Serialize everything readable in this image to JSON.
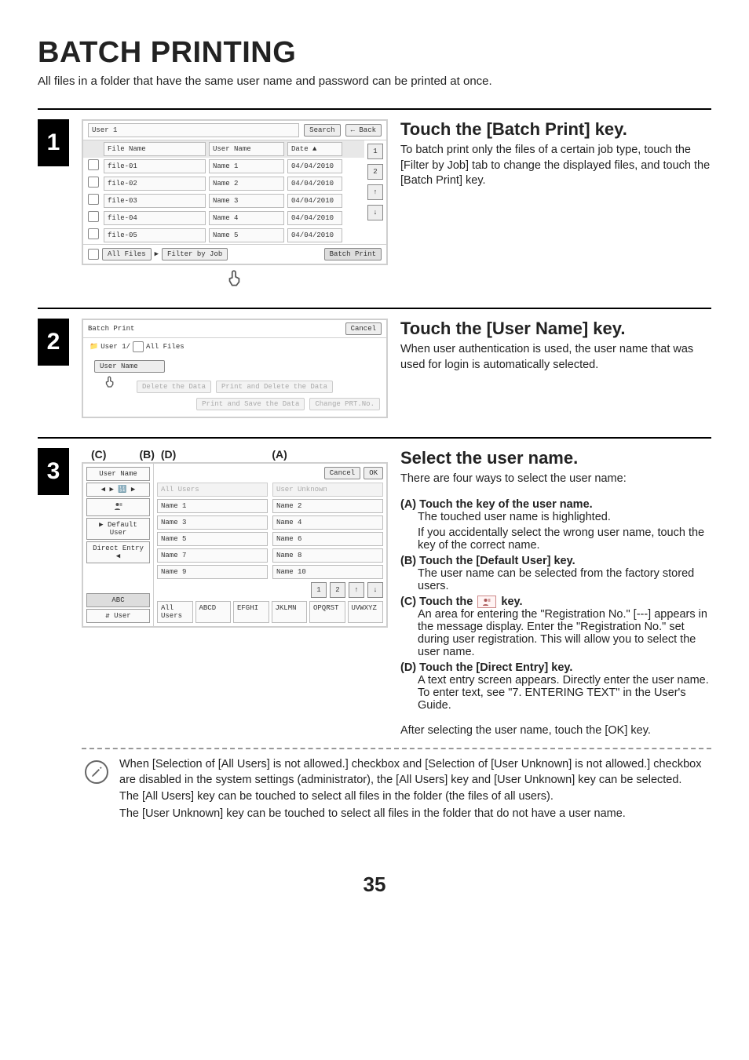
{
  "page": {
    "title": "BATCH PRINTING",
    "number": "35"
  },
  "intro": "All files in a folder that have the same user name and password can be printed at once.",
  "step1": {
    "heading": "Touch the [Batch Print] key.",
    "body": "To batch print only the files of a certain job type, touch the [Filter by Job] tab to change the displayed files, and touch the [Batch Print] key.",
    "panel": {
      "folder": "User 1",
      "search": "Search",
      "back": "Back",
      "cols": {
        "file": "File Name",
        "user": "User Name",
        "date": "Date"
      },
      "rows": [
        {
          "file": "file-01",
          "user": "Name 1",
          "date": "04/04/2010"
        },
        {
          "file": "file-02",
          "user": "Name 2",
          "date": "04/04/2010"
        },
        {
          "file": "file-03",
          "user": "Name 3",
          "date": "04/04/2010"
        },
        {
          "file": "file-04",
          "user": "Name 4",
          "date": "04/04/2010"
        },
        {
          "file": "file-05",
          "user": "Name 5",
          "date": "04/04/2010"
        }
      ],
      "pages": [
        "1",
        "2"
      ],
      "footer": {
        "all_files": "All Files",
        "filter": "Filter by Job",
        "batch": "Batch Print"
      }
    }
  },
  "step2": {
    "heading": "Touch the [User Name] key.",
    "body": "When user authentication is used, the user name that was used for login is automatically selected.",
    "panel": {
      "title": "Batch Print",
      "cancel": "Cancel",
      "crumb": "User 1/",
      "crumb2": "All Files",
      "user_name_btn": "User Name",
      "delete": "Delete the Data",
      "print_del": "Print and Delete the Data",
      "print_save": "Print and Save the Data",
      "change_prt": "Change PRT.No."
    }
  },
  "step3": {
    "heading": "Select the user name.",
    "lead": "There are four ways to select the user name:",
    "labels": {
      "A": "(A)",
      "B": "(B)",
      "C": "(C)",
      "D": "(D)"
    },
    "opts": {
      "A": {
        "t": "(A) Touch the key of the user name.",
        "d": [
          "The touched user name is highlighted.",
          "If you accidentally select the wrong user name, touch the key of the correct name."
        ]
      },
      "B": {
        "t": "(B) Touch the [Default User] key.",
        "d": [
          "The user name can be selected from the factory stored users."
        ]
      },
      "C": {
        "t": "(C) Touch the ",
        "t2": " key.",
        "d": [
          "An area for entering the \"Registration No.\" [---] appears in the message display. Enter the \"Registration No.\" set during user registration. This will allow you to select the user name."
        ]
      },
      "D": {
        "t": "(D) Touch the [Direct Entry] key.",
        "d": [
          "A text entry screen appears. Directly enter the user name. To enter text, see \"7. ENTERING TEXT\" in the User's Guide."
        ]
      }
    },
    "after": "After selecting the user name, touch the [OK] key.",
    "panel": {
      "title": "User Name",
      "cancel": "Cancel",
      "ok": "OK",
      "tabs": {
        "default": "Default User",
        "direct": "Direct Entry",
        "abc": "ABC",
        "user": "User"
      },
      "all_users": "All Users",
      "user_unknown": "User Unknown",
      "names": [
        "Name 1",
        "Name 2",
        "Name 3",
        "Name 4",
        "Name 5",
        "Name 6",
        "Name 7",
        "Name 8",
        "Name 9",
        "Name 10"
      ],
      "pages": [
        "1",
        "2"
      ],
      "alpha": [
        "All Users",
        "ABCD",
        "EFGHI",
        "JKLMN",
        "OPQRST",
        "UVWXYZ"
      ]
    }
  },
  "note": {
    "l1": "When [Selection of [All Users] is not allowed.] checkbox and [Selection of [User Unknown] is not allowed.] checkbox are disabled in the system settings (administrator), the [All Users] key and [User Unknown] key can be selected.",
    "l2": "The [All Users] key can be touched to select all files in the folder (the files of all users).",
    "l3": "The [User Unknown] key can be touched to select all files in the folder that do not have a user name."
  }
}
